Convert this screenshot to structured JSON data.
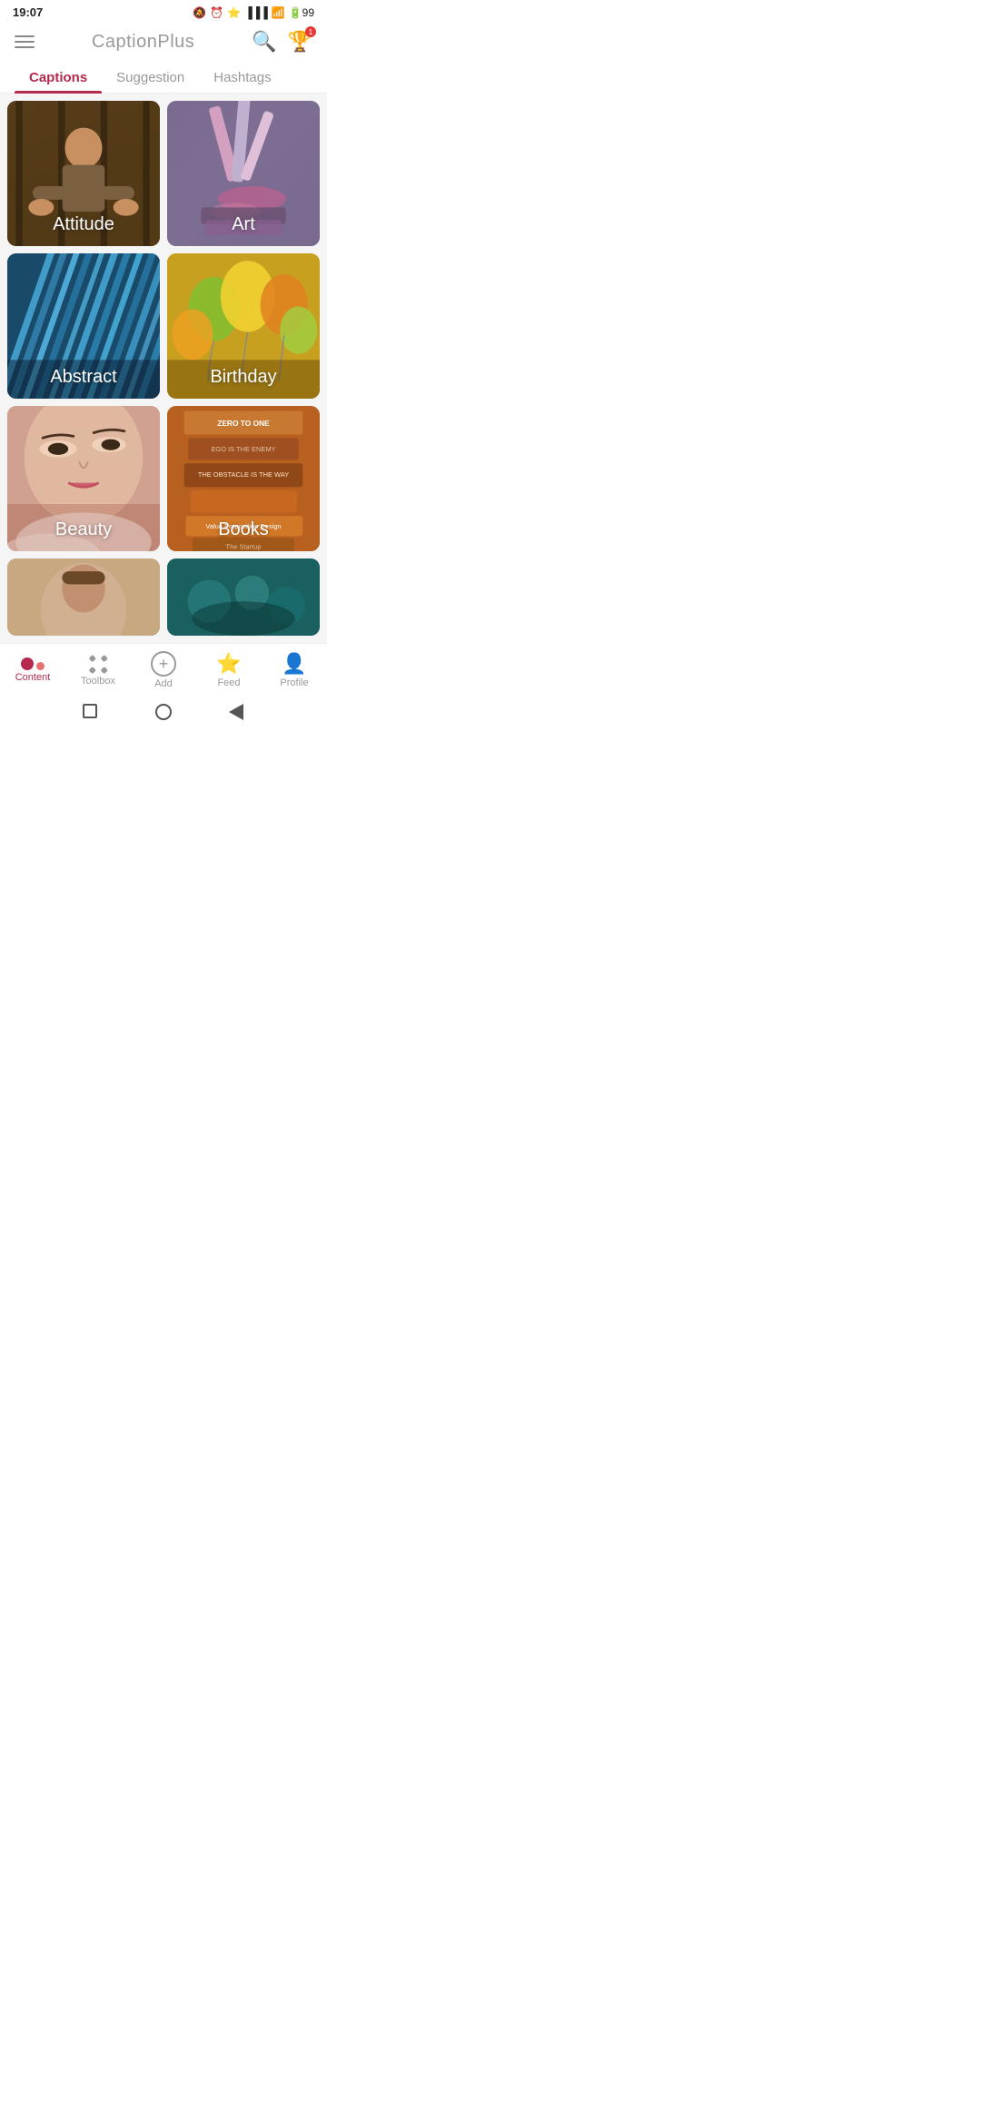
{
  "statusBar": {
    "time": "19:07",
    "batteryLevel": "99"
  },
  "topBar": {
    "title": "CaptionPlus"
  },
  "tabs": [
    {
      "id": "captions",
      "label": "Captions",
      "active": true
    },
    {
      "id": "suggestion",
      "label": "Suggestion",
      "active": false
    },
    {
      "id": "hashtags",
      "label": "Hashtags",
      "active": false
    }
  ],
  "categories": [
    {
      "id": "attitude",
      "label": "Attitude",
      "bgClass": "bg-attitude"
    },
    {
      "id": "art",
      "label": "Art",
      "bgClass": "bg-art"
    },
    {
      "id": "abstract",
      "label": "Abstract",
      "bgClass": "bg-abstract"
    },
    {
      "id": "birthday",
      "label": "Birthday",
      "bgClass": "bg-birthday"
    },
    {
      "id": "beauty",
      "label": "Beauty",
      "bgClass": "bg-beauty"
    },
    {
      "id": "books",
      "label": "Books",
      "bgClass": "bg-books"
    }
  ],
  "partialCategories": [
    {
      "id": "partial1",
      "bgClass": "bg-partial1"
    },
    {
      "id": "partial2",
      "bgClass": "bg-partial2"
    }
  ],
  "bottomNav": {
    "items": [
      {
        "id": "content",
        "label": "Content",
        "active": true
      },
      {
        "id": "toolbox",
        "label": "Toolbox",
        "active": false
      },
      {
        "id": "add",
        "label": "Add",
        "active": false
      },
      {
        "id": "feed",
        "label": "Feed",
        "active": false
      },
      {
        "id": "profile",
        "label": "Profile",
        "active": false
      }
    ]
  }
}
